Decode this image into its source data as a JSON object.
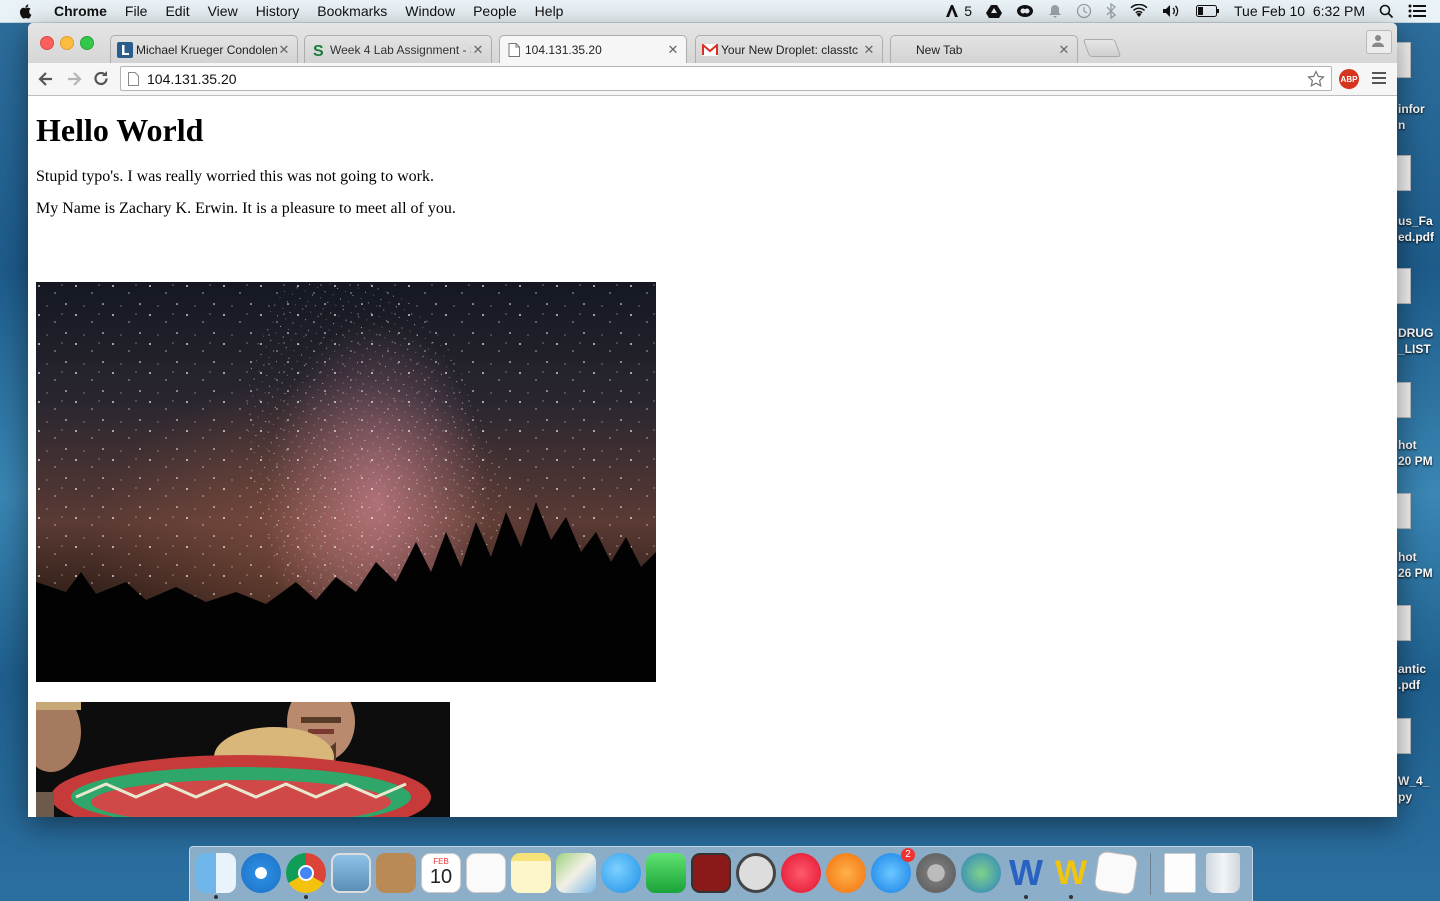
{
  "menubar": {
    "app_name": "Chrome",
    "items": [
      "File",
      "Edit",
      "View",
      "History",
      "Bookmarks",
      "Window",
      "People",
      "Help"
    ],
    "status": {
      "adobe_count": "5",
      "datetime": "Tue Feb 10  6:32 PM"
    }
  },
  "browser": {
    "tabs": [
      {
        "title": "Michael Krueger Condolen",
        "favicon": "legacy-l-icon",
        "active": false
      },
      {
        "title": "Week 4 Lab Assignment - S",
        "favicon": "green-s-icon",
        "active": false
      },
      {
        "title": "104.131.35.20",
        "favicon": "page-icon",
        "active": true
      },
      {
        "title": "Your New Droplet: classtc",
        "favicon": "gmail-icon",
        "active": false
      },
      {
        "title": "New Tab",
        "favicon": "",
        "active": false
      }
    ],
    "address": "104.131.35.20",
    "extension_label": "ABP"
  },
  "page": {
    "heading": "Hello World",
    "paragraph_1": "Stupid typo's. I was really worried this was not going to work.",
    "paragraph_2": "My Name is Zachary K. Erwin. It is a pleasure to meet all of you."
  },
  "desktop": {
    "labels": [
      "infor",
      "n",
      "us_Fa",
      "ed.pdf",
      "DRUG",
      "_LIST",
      "hot",
      "20 PM",
      "hot",
      "26 PM",
      "antic",
      ".pdf",
      "W_4_",
      "py"
    ]
  },
  "dock": {
    "calendar_month": "FEB",
    "calendar_day": "10",
    "appstore_badge": "2",
    "apps": [
      "finder-icon",
      "safari-icon",
      "chrome-icon",
      "preview-icon",
      "contacts-icon",
      "calendar-icon",
      "reminders-icon",
      "notes-icon",
      "maps-icon",
      "messages-icon",
      "facetime-icon",
      "photo-booth-icon",
      "no-entry-icon",
      "itunes-icon",
      "ibooks-icon",
      "app-store-icon",
      "system-preferences-icon",
      "network-icon",
      "word-icon",
      "wunderlist-icon",
      "textedit-icon",
      "document-icon",
      "trash-icon"
    ]
  }
}
